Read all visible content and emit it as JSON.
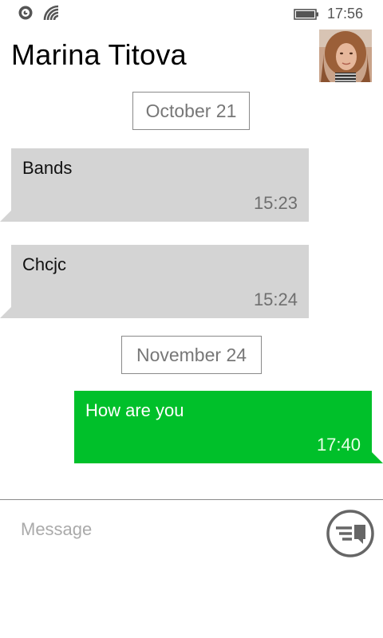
{
  "status_bar": {
    "time": "17:56",
    "icons": [
      "signal-status-icon",
      "wifi-icon",
      "battery-icon"
    ]
  },
  "header": {
    "contact_name": "Marina Titova",
    "avatar_icon": "contact-avatar"
  },
  "conversation": {
    "date_separators": [
      "October 21",
      "November 24"
    ],
    "messages": [
      {
        "direction": "incoming",
        "text": "Bands",
        "time": "15:23"
      },
      {
        "direction": "incoming",
        "text": "Chcjc",
        "time": "15:24"
      },
      {
        "direction": "outgoing",
        "text": "How are you",
        "time": "17:40"
      }
    ]
  },
  "composer": {
    "placeholder": "Message",
    "value": "",
    "send_icon": "send-message-icon"
  },
  "colors": {
    "incoming_bubble": "#d4d4d4",
    "outgoing_bubble": "#00c02a",
    "separator_border": "#8a8a8a"
  }
}
